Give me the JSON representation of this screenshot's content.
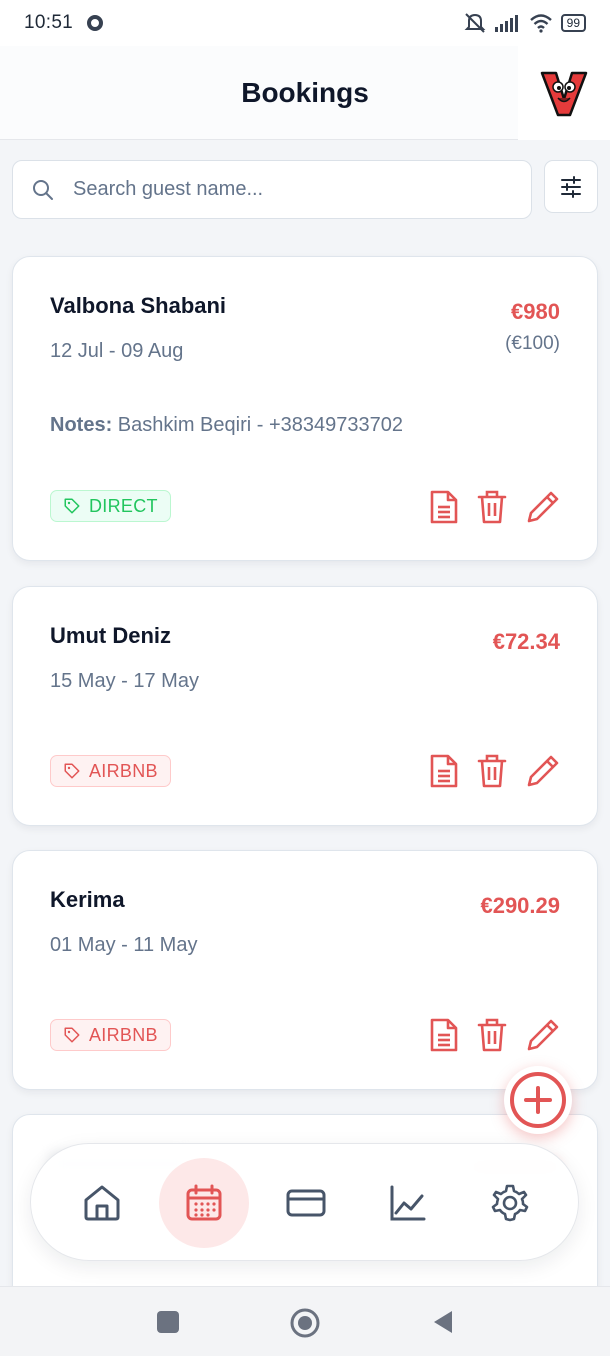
{
  "status_bar": {
    "time": "10:51",
    "battery": "99"
  },
  "header": {
    "title": "Bookings"
  },
  "search": {
    "placeholder": "Search guest name..."
  },
  "bookings": [
    {
      "guest": "Valbona Shabani",
      "dates": "12 Jul - 09 Aug",
      "price": "€980",
      "deposit": "(€100)",
      "notes_label": "Notes:",
      "notes": "Bashkim Beqiri - +38349733702",
      "source": "DIRECT"
    },
    {
      "guest": "Umut Deniz",
      "dates": "15 May - 17 May",
      "price": "€72.34",
      "source": "AIRBNB"
    },
    {
      "guest": "Kerima",
      "dates": "01 May - 11 May",
      "price": "€290.29",
      "source": "AIRBNB"
    }
  ],
  "nav": {
    "items": [
      {
        "name": "home",
        "icon": "home-icon"
      },
      {
        "name": "bookings",
        "icon": "calendar-icon",
        "active": true
      },
      {
        "name": "payments",
        "icon": "credit-card-icon"
      },
      {
        "name": "stats",
        "icon": "chart-line-icon"
      },
      {
        "name": "settings",
        "icon": "gear-icon"
      }
    ]
  },
  "colors": {
    "accent": "#e25555",
    "direct": "#22c55e",
    "muted": "#64748b",
    "nav_icon": "#475569"
  }
}
